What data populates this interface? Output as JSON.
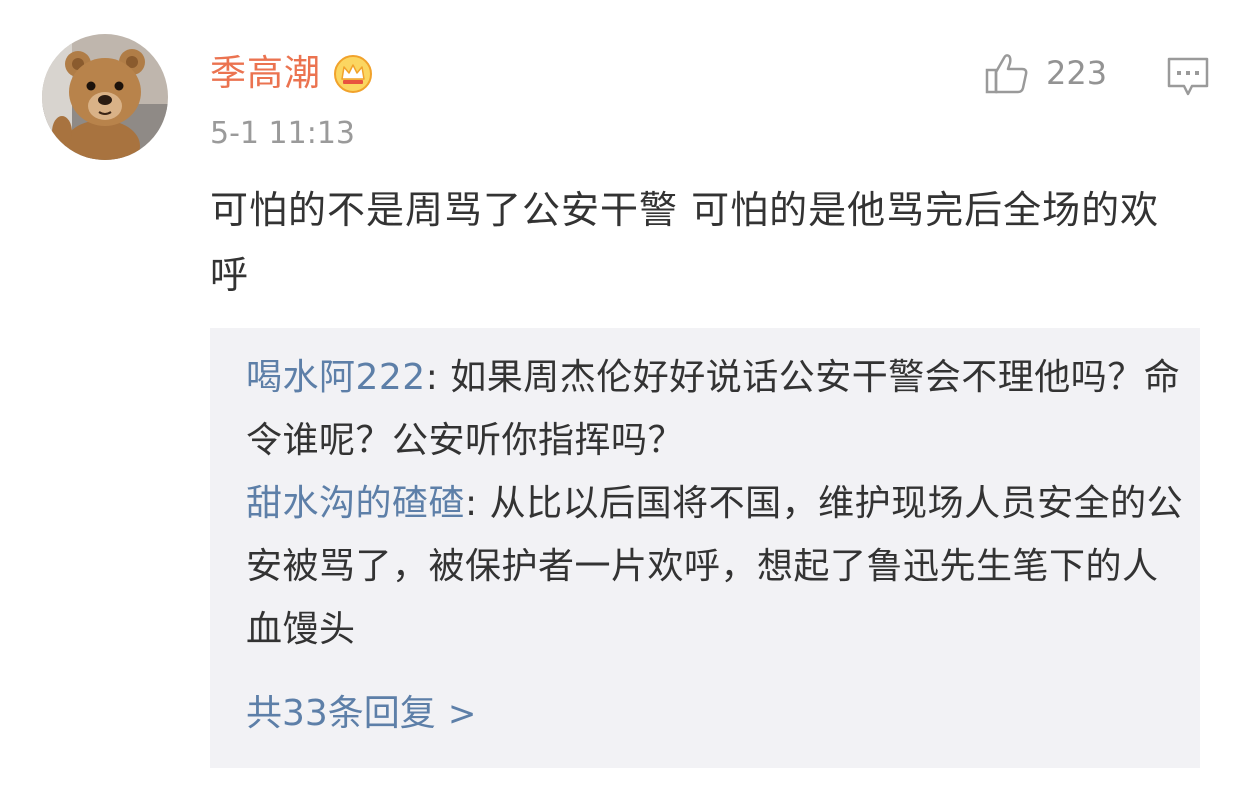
{
  "comment": {
    "username": "季高潮",
    "timestamp": "5-1 11:13",
    "like_count": "223",
    "text": "可怕的不是周骂了公安干警 可怕的是他骂完后全场的欢呼",
    "icons": {
      "badge": "crown-badge-icon",
      "like": "thumbs-up-icon",
      "reply": "comment-bubble-icon",
      "more": "chevron-right-icon"
    },
    "colors": {
      "username": "#eb7350",
      "link": "#5d7fa8",
      "meta": "#9a9a9a",
      "reply_bg": "#f2f2f5"
    }
  },
  "replies": [
    {
      "author": "喝水阿222",
      "separator": ": ",
      "text": "如果周杰伦好好说话公安干警会不理他吗？命令谁呢？公安听你指挥吗？"
    },
    {
      "author": "甜水沟的碴碴",
      "separator": ": ",
      "text": "从比以后国将不国，维护现场人员安全的公安被骂了，被保护者一片欢呼，想起了鲁迅先生笔下的人血馒头"
    }
  ],
  "more_replies": {
    "label": "共33条回复",
    "chevron": ">"
  }
}
